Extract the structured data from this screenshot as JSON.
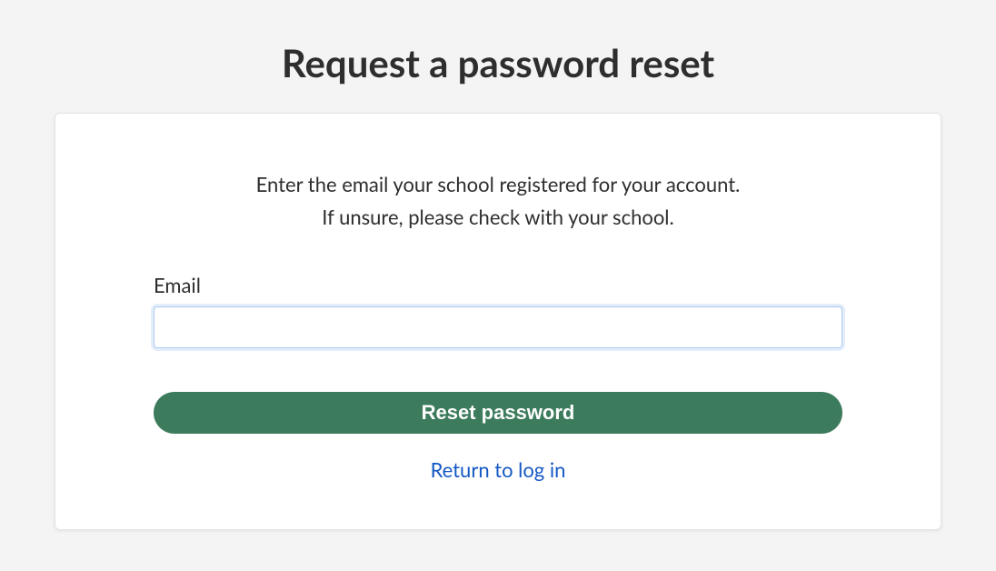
{
  "page": {
    "title": "Request a password reset"
  },
  "form": {
    "instruction_line1": "Enter the email your school registered for your account.",
    "instruction_line2": "If unsure, please check with your school.",
    "email_label": "Email",
    "email_value": "",
    "submit_label": "Reset password",
    "return_link_label": "Return to log in"
  }
}
